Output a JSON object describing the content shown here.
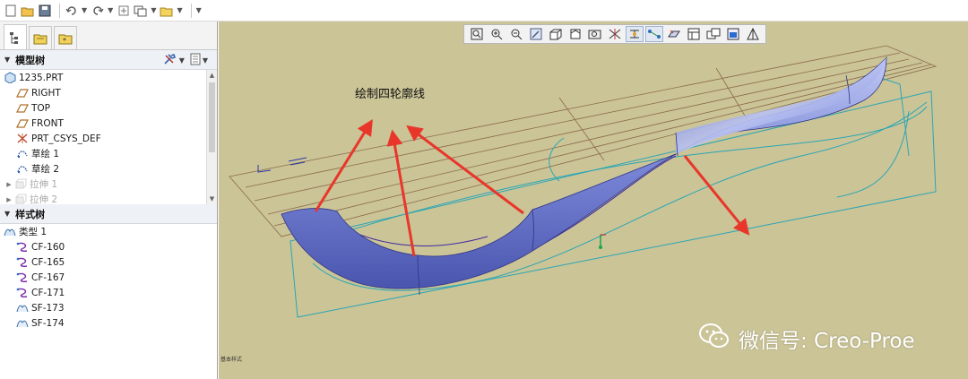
{
  "quick_access": {
    "icons": [
      "new-file-icon",
      "open-file-icon",
      "save-icon",
      "undo-icon",
      "redo-icon",
      "regenerate-icon",
      "window-icon",
      "folder-icon",
      "customize-icon"
    ]
  },
  "left_panel": {
    "tabs": [
      "model-tree-tab",
      "folder-browser-tab",
      "favorites-tab"
    ],
    "model_tree": {
      "title": "模型树",
      "items": [
        {
          "label": "1235.PRT",
          "icon": "part-icon",
          "expandable": false,
          "dim": false
        },
        {
          "label": "RIGHT",
          "icon": "datum-plane-icon",
          "expandable": false,
          "dim": false
        },
        {
          "label": "TOP",
          "icon": "datum-plane-icon",
          "expandable": false,
          "dim": false
        },
        {
          "label": "FRONT",
          "icon": "datum-plane-icon",
          "expandable": false,
          "dim": false
        },
        {
          "label": "PRT_CSYS_DEF",
          "icon": "csys-icon",
          "expandable": false,
          "dim": false
        },
        {
          "label": "草绘 1",
          "icon": "sketch-icon",
          "expandable": false,
          "dim": false
        },
        {
          "label": "草绘 2",
          "icon": "sketch-icon",
          "expandable": false,
          "dim": false
        },
        {
          "label": "拉伸 1",
          "icon": "extrude-icon",
          "expandable": true,
          "dim": true
        },
        {
          "label": "拉伸 2",
          "icon": "extrude-icon",
          "expandable": true,
          "dim": true
        }
      ]
    },
    "style_tree": {
      "title": "样式树",
      "items": [
        {
          "label": "类型 1",
          "icon": "style-type-icon"
        },
        {
          "label": "CF-160",
          "icon": "curve-icon"
        },
        {
          "label": "CF-165",
          "icon": "curve-icon"
        },
        {
          "label": "CF-167",
          "icon": "curve-icon"
        },
        {
          "label": "CF-171",
          "icon": "curve-icon"
        },
        {
          "label": "SF-173",
          "icon": "surface-icon"
        },
        {
          "label": "SF-174",
          "icon": "surface-icon"
        }
      ]
    }
  },
  "viewport": {
    "background": "#cbc497",
    "annotation": "绘制四轮廓线",
    "status_mini": "基本样式",
    "watermark": "微信号: Creo-Proe",
    "view_toolbar_icons": [
      "refit-icon",
      "zoom-in-icon",
      "zoom-out-icon",
      "repaint-icon",
      "display-style-icon",
      "saved-views-icon",
      "view-manager-icon",
      "datum-display-icon",
      "spin-center-icon",
      "annotation-display-icon",
      "plane-display-icon",
      "axis-display-icon",
      "point-display-icon",
      "csys-display-icon"
    ],
    "colors": {
      "surface": "#6f7fd6",
      "curve": "#3f2aa0",
      "datum": "#2aa6b4",
      "arrow": "#e8372a",
      "grid": "#8a6a4c"
    }
  }
}
